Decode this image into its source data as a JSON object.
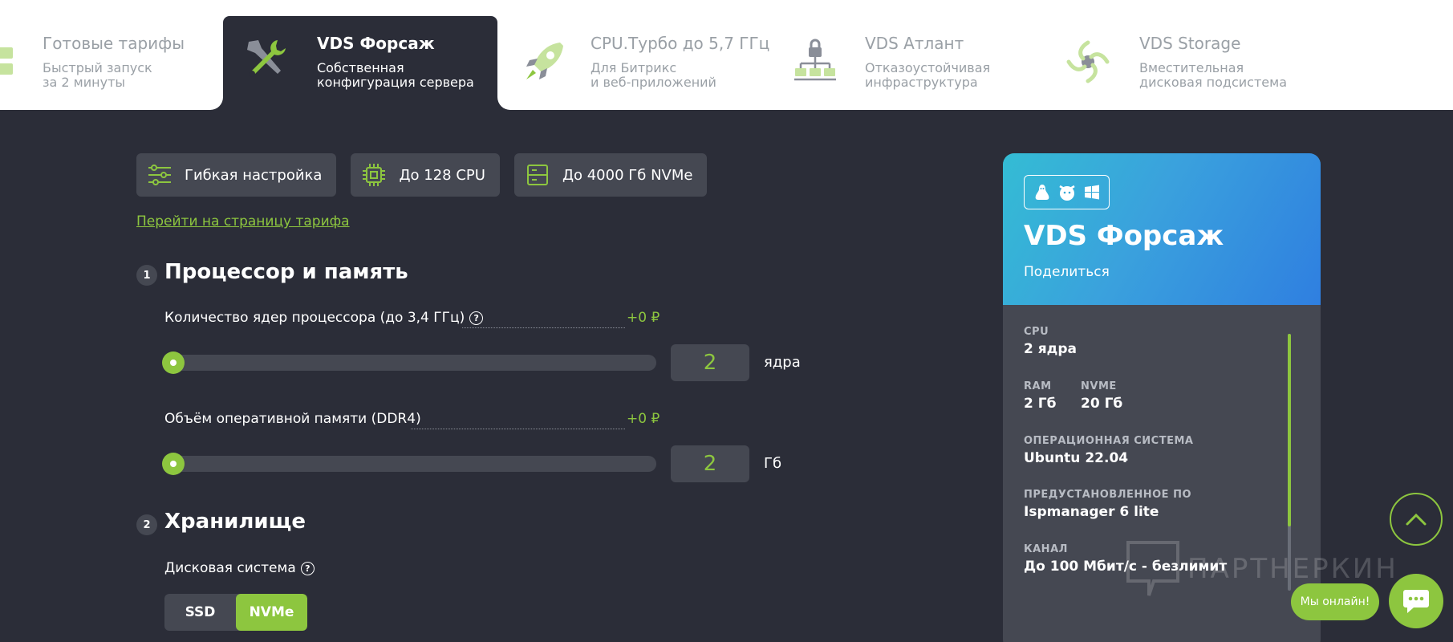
{
  "tabs": [
    {
      "title": "Готовые тарифы",
      "sub1": "Быстрый запуск",
      "sub2": "за 2 минуты"
    },
    {
      "title": "VDS Форсаж",
      "sub1": "Собственная",
      "sub2": "конфигурация сервера"
    },
    {
      "title": "CPU.Турбо до 5,7 ГГц",
      "sub1": "Для Битрикс",
      "sub2": "и веб-приложений"
    },
    {
      "title": "VDS Атлант",
      "sub1": "Отказоустойчивая",
      "sub2": "инфраструктура"
    },
    {
      "title": "VDS Storage",
      "sub1": "Вместительная",
      "sub2": "дисковая подсистема"
    }
  ],
  "chips": [
    "Гибкая настройка",
    "До 128 CPU",
    "До 4000 Гб NVMe"
  ],
  "tariff_link": "Перейти на страницу тарифа",
  "section1": {
    "num": "1",
    "title": "Процессор и память",
    "cpu": {
      "label": "Количество ядер процессора (до 3,4 ГГц)",
      "price": "+0 ₽",
      "value": "2",
      "unit": "ядра",
      "fill": 0
    },
    "ram": {
      "label": "Объём оперативной памяти (DDR4)",
      "price": "+0 ₽",
      "value": "2",
      "unit": "Гб",
      "fill": 0
    }
  },
  "section2": {
    "num": "2",
    "title": "Хранилище",
    "disk_label": "Дисковая система",
    "options": [
      "SSD",
      "NVMe"
    ],
    "selected": "NVMe"
  },
  "card": {
    "title": "VDS Форсаж",
    "share": "Поделиться",
    "os_icons": [
      "linux-icon",
      "freebsd-icon",
      "windows-icon"
    ],
    "specs": {
      "cpu_k": "CPU",
      "cpu_v": "2 ядра",
      "ram_k": "RAM",
      "ram_v": "2 Гб",
      "nvme_k": "NVME",
      "nvme_v": "20 Гб",
      "os_k": "ОПЕРАЦИОННАЯ СИСТЕМА",
      "os_v": "Ubuntu 22.04",
      "po_k": "ПРЕДУСТАНОВЛЕННОЕ ПО",
      "po_v": "Ispmanager 6 lite",
      "ch_k": "КАНАЛ",
      "ch_v": "До 100 Мбит/с - безлимит"
    }
  },
  "watermark": "ПАРТНЕРКИН",
  "online": "Мы онлайн!",
  "colors": {
    "accent": "#8dc63f",
    "bg": "#2b2d38",
    "panel": "#454852"
  }
}
